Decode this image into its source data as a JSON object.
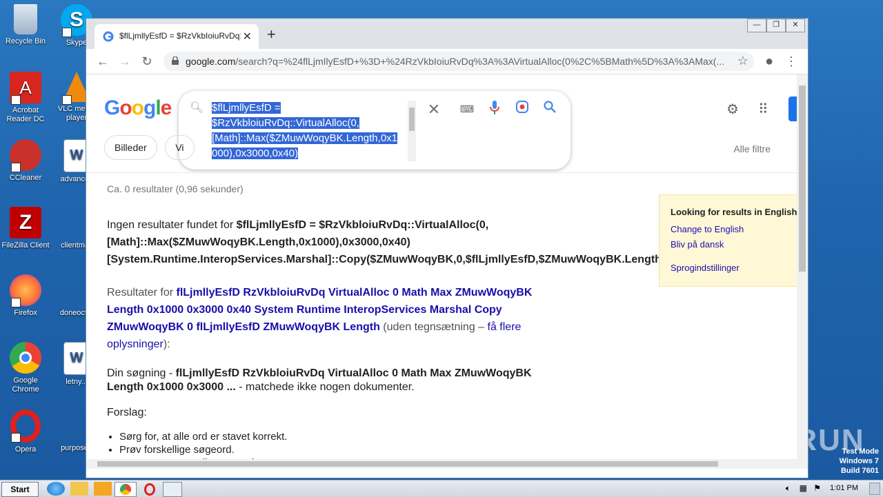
{
  "desktop": {
    "icons": [
      {
        "label": "Recycle Bin"
      },
      {
        "label": "Skype"
      },
      {
        "label": "Acrobat Reader DC"
      },
      {
        "label": "VLC media player"
      },
      {
        "label": "CCleaner"
      },
      {
        "label": "advancec"
      },
      {
        "label": "FileZilla Client"
      },
      {
        "label": "clientmail"
      },
      {
        "label": "Firefox"
      },
      {
        "label": "doneoct..."
      },
      {
        "label": "Google Chrome"
      },
      {
        "label": "letny..."
      },
      {
        "label": "Opera"
      },
      {
        "label": "purposed"
      }
    ],
    "watermark": "ANY RUN",
    "test_mode": {
      "line1": "Test Mode",
      "line2": "Windows 7",
      "line3": "Build 7601"
    }
  },
  "browser": {
    "tab_title": "$flLjmllyEsfD = $RzVkbIoiuRvDq::Vi",
    "url_host": "google.com",
    "url_rest": "/search?q=%24flLjmIlyEsfD+%3D+%24RzVkbIoiuRvDq%3A%3AVirtualAlloc(0%2C%5BMath%5D%3A%3AMax(...",
    "window_controls": {
      "minimize": "—",
      "restore": "❐",
      "close": "✕"
    }
  },
  "google": {
    "logo": "Google",
    "query_lines": [
      "$flLjmllyEsfD =",
      "$RzVkbloiuRvDq::VirtualAlloc(0,",
      "[Math]::Max($ZMuwWoqyBK.Length,0x1",
      "000),0x3000,0x40)"
    ],
    "chips": [
      "Billeder",
      "Vi"
    ],
    "all_filters": "Alle filtre",
    "stats": "Ca. 0 resultater (0,96 sekunder)",
    "no_results_prefix": "Ingen resultater fundet for ",
    "no_results_query_1": "$flLjmllyEsfD = $RzVkbloiuRvDq::VirtualAlloc(0,",
    "no_results_query_2": "[Math]::Max($ZMuwWoqyBK.Length,0x1000),0x3000,0x40)",
    "no_results_query_3": "[System.Runtime.InteropServices.Marshal]::Copy($ZMuwWoqyBK,0,$flLjmllyEsfD,$ZMuwWoqyBK.Length)",
    "results_for_prefix": "Resultater for ",
    "results_for_link": "flLjmllyEsfD RzVkbloiuRvDq VirtualAlloc 0 Math Max ZMuwWoqyBK Length 0x1000 0x3000 0x40 System Runtime InteropServices Marshal Copy ZMuwWoqyBK 0 flLjmllyEsfD ZMuwWoqyBK Length",
    "results_for_note": " (uden tegnsætning – ",
    "results_for_more": "få flere oplysninger",
    "results_for_end": "):",
    "din_prefix": "Din søgning - ",
    "din_query": "flLjmllyEsfD RzVkbloiuRvDq VirtualAlloc 0 Math Max ZMuwWoqyBK Length 0x1000 0x3000 ...",
    "din_suffix": " - matchede ikke nogen dokumenter.",
    "forslag": "Forslag:",
    "suggestions": [
      "Sørg for, at alle ord er stavet korrekt.",
      "Prøv forskellige søgeord.",
      "Prøv mere generelle søgeord."
    ],
    "lang_box": {
      "heading": "Looking for results in English?",
      "change": "Change to English",
      "dansk": "Bliv på dansk",
      "settings": "Sprogindstillinger"
    }
  },
  "taskbar": {
    "start": "Start",
    "clock": "1:01 PM"
  }
}
